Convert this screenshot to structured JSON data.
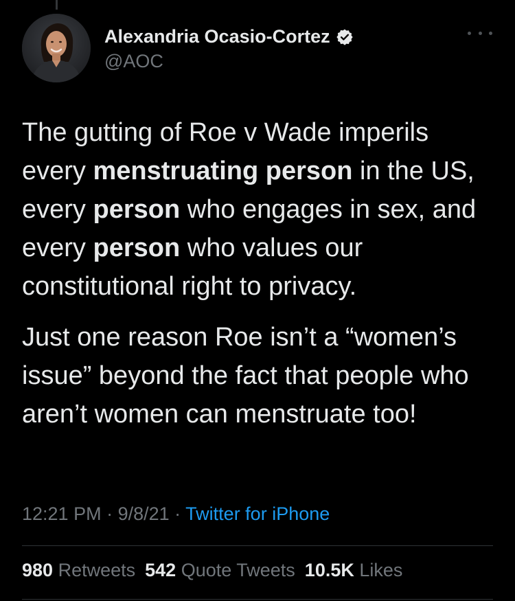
{
  "author": {
    "display_name": "Alexandria Ocasio-Cortez",
    "handle": "@AOC",
    "verified": true,
    "avatar_icon": "profile-photo"
  },
  "tweet": {
    "p1": {
      "t1": "The gutting of Roe v Wade imperils every ",
      "b1": "menstruating person",
      "t2": " in the US, every ",
      "b2": "person",
      "t3": " who engages in sex, and every ",
      "b3": "person",
      "t4": " who values our constitutional right to privacy."
    },
    "p2": "Just one reason Roe isn’t a “women’s issue” beyond the fact that people who aren’t women can menstruate too!"
  },
  "meta": {
    "time": "12:21 PM",
    "sep1": " · ",
    "date": "9/8/21",
    "sep2": " · ",
    "source": "Twitter for iPhone"
  },
  "stats": {
    "retweets_count": "980",
    "retweets_label": " Retweets",
    "quotes_count": "542",
    "quotes_label": " Quote Tweets",
    "likes_count": "10.5K",
    "likes_label": " Likes"
  },
  "colors": {
    "background": "#000000",
    "text": "#e7e9ea",
    "muted": "#71767b",
    "link": "#1d9bf0",
    "verified_badge": "#e7e9ea"
  },
  "icons": {
    "verified": "verified-badge-icon",
    "more": "more-options-icon"
  }
}
